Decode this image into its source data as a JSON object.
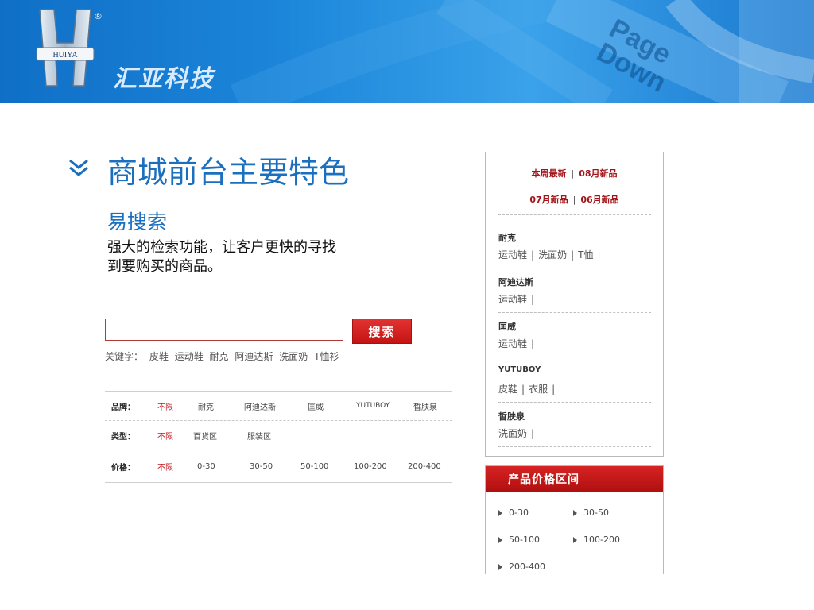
{
  "banner": {
    "logo_text": "HUIYA",
    "registered": "®",
    "brand_name": "汇亚科技",
    "page_down": [
      "Page",
      "Down"
    ]
  },
  "slide": {
    "title": "商城前台主要特色",
    "subtitle": "易搜索",
    "description_line1": "强大的检索功能，让客户更快的寻找",
    "description_line2": "到要购买的商品。"
  },
  "search": {
    "input_value": "",
    "button_label": "搜索",
    "keywords_label": "关键字：",
    "keywords": [
      "皮鞋",
      "运动鞋",
      "耐克",
      "阿迪达斯",
      "洗面奶",
      "T恤衫"
    ]
  },
  "filters": {
    "rows": [
      {
        "label": "品牌：",
        "default": "不限",
        "options": [
          "耐克",
          "阿迪达斯",
          "匡威",
          "YUTUBOY",
          "皙肤泉"
        ]
      },
      {
        "label": "类型：",
        "default": "不限",
        "options": [
          "百货区",
          "服装区"
        ]
      },
      {
        "label": "价格：",
        "default": "不限",
        "options": [
          "0-30",
          "30-50",
          "50-100",
          "100-200",
          "200-400"
        ]
      }
    ]
  },
  "sidebar": {
    "new_links_row1": [
      "本周最新",
      "08月新品"
    ],
    "new_links_row2": [
      "07月新品",
      "06月新品"
    ],
    "brands": [
      {
        "name": "耐克",
        "items": [
          "运动鞋",
          "洗面奶",
          "T恤"
        ]
      },
      {
        "name": "阿迪达斯",
        "items": [
          "运动鞋"
        ]
      },
      {
        "name": "匡威",
        "items": [
          "运动鞋"
        ]
      },
      {
        "name": "YUTUBOY",
        "items": [
          "皮鞋",
          "衣服"
        ]
      },
      {
        "name": "皙肤泉",
        "items": [
          "洗面奶"
        ]
      }
    ]
  },
  "price_range": {
    "title": "产品价格区间",
    "items": [
      "0-30",
      "30-50",
      "50-100",
      "100-200",
      "200-400"
    ]
  },
  "colors": {
    "accent_blue": "#1b6fbf",
    "accent_red": "#c31414",
    "link_red": "#a3141a"
  }
}
